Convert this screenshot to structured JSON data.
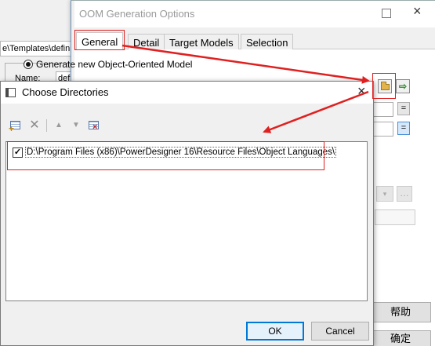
{
  "background_window": {
    "path_text": "e\\Templates\\defini",
    "name_label": "Name:",
    "name_value": "defi"
  },
  "oom_window": {
    "title": "OOM Generation Options",
    "tabs": [
      {
        "label": "General"
      },
      {
        "label": "Detail"
      },
      {
        "label": "Target Models"
      },
      {
        "label": "Selection"
      }
    ],
    "radio_label": "Generate new Object-Oriented Model",
    "small_btn_label": "=",
    "help_label": "帮助",
    "confirm_label": "确定"
  },
  "dialog": {
    "title": "Choose Directories",
    "directories": [
      {
        "path": "D:\\Program Files (x86)\\PowerDesigner 16\\Resource Files\\Object Languages\\",
        "checked": true
      }
    ],
    "check_glyph": "✓",
    "ok_label": "OK",
    "cancel_label": "Cancel"
  },
  "icons": {
    "close": "×",
    "delete": "✕",
    "up": "▲",
    "down": "▼",
    "import": "⇨",
    "dropdown": "▾",
    "ellipsis": "…"
  },
  "colors": {
    "annotation": "#e02020",
    "ok_border": "#0078d7"
  }
}
